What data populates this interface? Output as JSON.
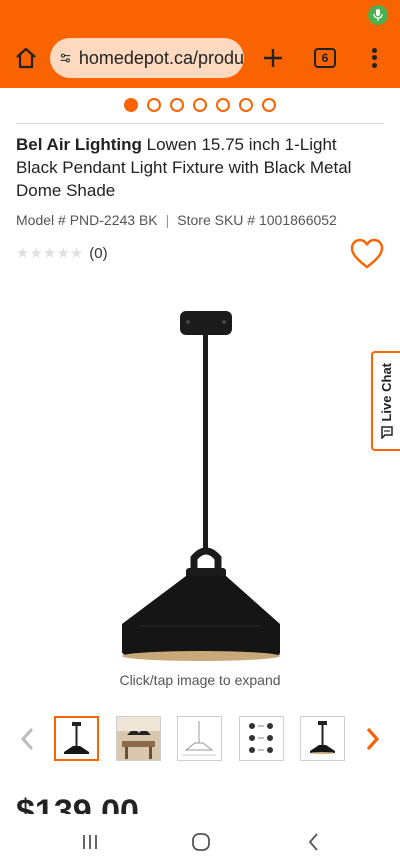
{
  "browser": {
    "url": "homedepot.ca/produ",
    "tab_count": "6"
  },
  "carousel": {
    "total_dots": 7,
    "active_index": 0
  },
  "product": {
    "brand": "Bel Air Lighting",
    "name": " Lowen 15.75 inch 1-Light Black Pendant Light Fixture with Black Metal Dome Shade",
    "model": "Model # PND-2243 BK",
    "separator": "|",
    "sku": "Store SKU # 1001866052",
    "rating_count": "(0)",
    "rating_stars": 0,
    "expand_hint": "Click/tap image to expand",
    "price": "$139.00"
  },
  "live_chat": {
    "label": "Live Chat"
  },
  "colors": {
    "accent": "#f96302"
  },
  "icons": {
    "home": "home-icon",
    "site_settings": "tune-icon",
    "new_tab": "plus-icon",
    "menu": "more-vert-icon",
    "favorite": "heart-icon",
    "chat": "chat-icon",
    "prev": "chevron-left-icon",
    "next": "chevron-right-icon",
    "mic": "mic-icon"
  }
}
